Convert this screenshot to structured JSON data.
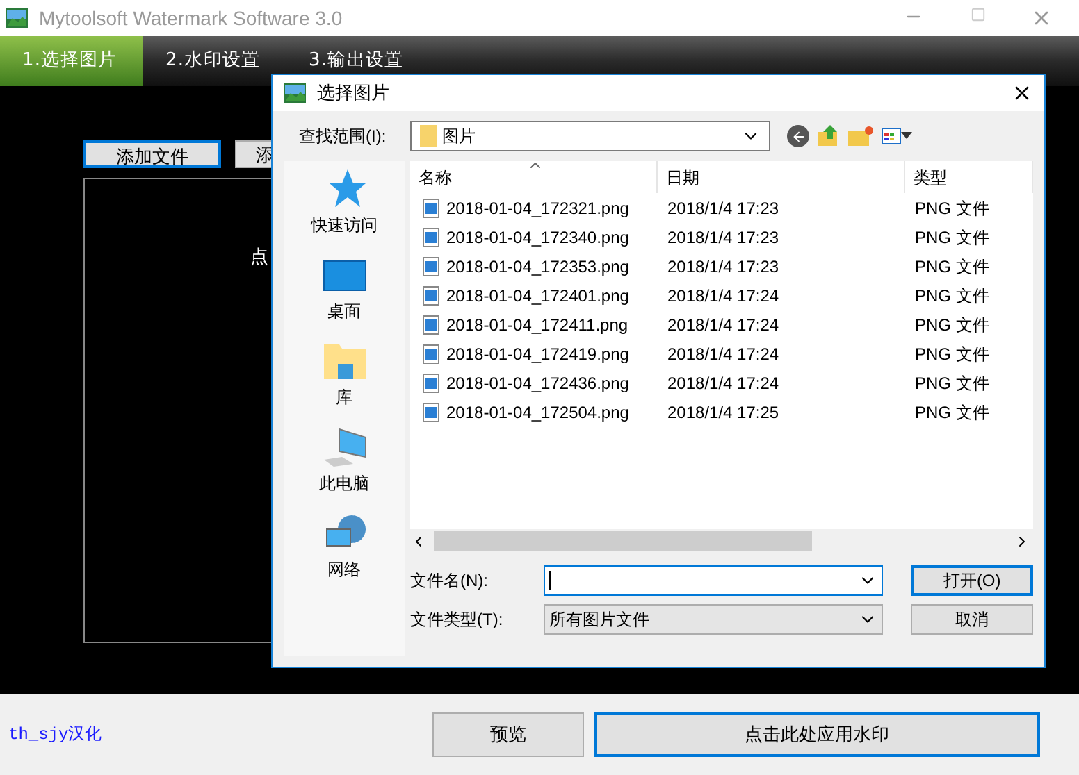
{
  "window": {
    "title": "Mytoolsoft Watermark Software 3.0"
  },
  "steps": [
    {
      "label": "1.选择图片",
      "selected": true
    },
    {
      "label": "2.水印设置",
      "selected": false
    },
    {
      "label": "3.输出设置",
      "selected": false
    }
  ],
  "toolbar": {
    "add_files": "添加文件",
    "second_button": "添"
  },
  "drop_area": {
    "hint": "点"
  },
  "footer": {
    "credit": "th_sjy汉化",
    "preview": "预览",
    "apply": "点击此处应用水印"
  },
  "dialog": {
    "title": "选择图片",
    "look_in_label": "查找范围(I):",
    "look_in_value": "图片",
    "places": [
      {
        "label": "快速访问",
        "kind": "star"
      },
      {
        "label": "桌面",
        "kind": "desktop"
      },
      {
        "label": "库",
        "kind": "library"
      },
      {
        "label": "此电脑",
        "kind": "computer"
      },
      {
        "label": "网络",
        "kind": "network"
      }
    ],
    "columns": [
      "名称",
      "日期",
      "类型"
    ],
    "files": [
      {
        "name": "2018-01-04_172321.png",
        "date": "2018/1/4 17:23",
        "type": "PNG 文件"
      },
      {
        "name": "2018-01-04_172340.png",
        "date": "2018/1/4 17:23",
        "type": "PNG 文件"
      },
      {
        "name": "2018-01-04_172353.png",
        "date": "2018/1/4 17:23",
        "type": "PNG 文件"
      },
      {
        "name": "2018-01-04_172401.png",
        "date": "2018/1/4 17:24",
        "type": "PNG 文件"
      },
      {
        "name": "2018-01-04_172411.png",
        "date": "2018/1/4 17:24",
        "type": "PNG 文件"
      },
      {
        "name": "2018-01-04_172419.png",
        "date": "2018/1/4 17:24",
        "type": "PNG 文件"
      },
      {
        "name": "2018-01-04_172436.png",
        "date": "2018/1/4 17:24",
        "type": "PNG 文件"
      },
      {
        "name": "2018-01-04_172504.png",
        "date": "2018/1/4 17:25",
        "type": "PNG 文件"
      }
    ],
    "filename_label": "文件名(N):",
    "filetype_label": "文件类型(T):",
    "filetype_value": "所有图片文件",
    "open": "打开(O)",
    "cancel": "取消"
  }
}
